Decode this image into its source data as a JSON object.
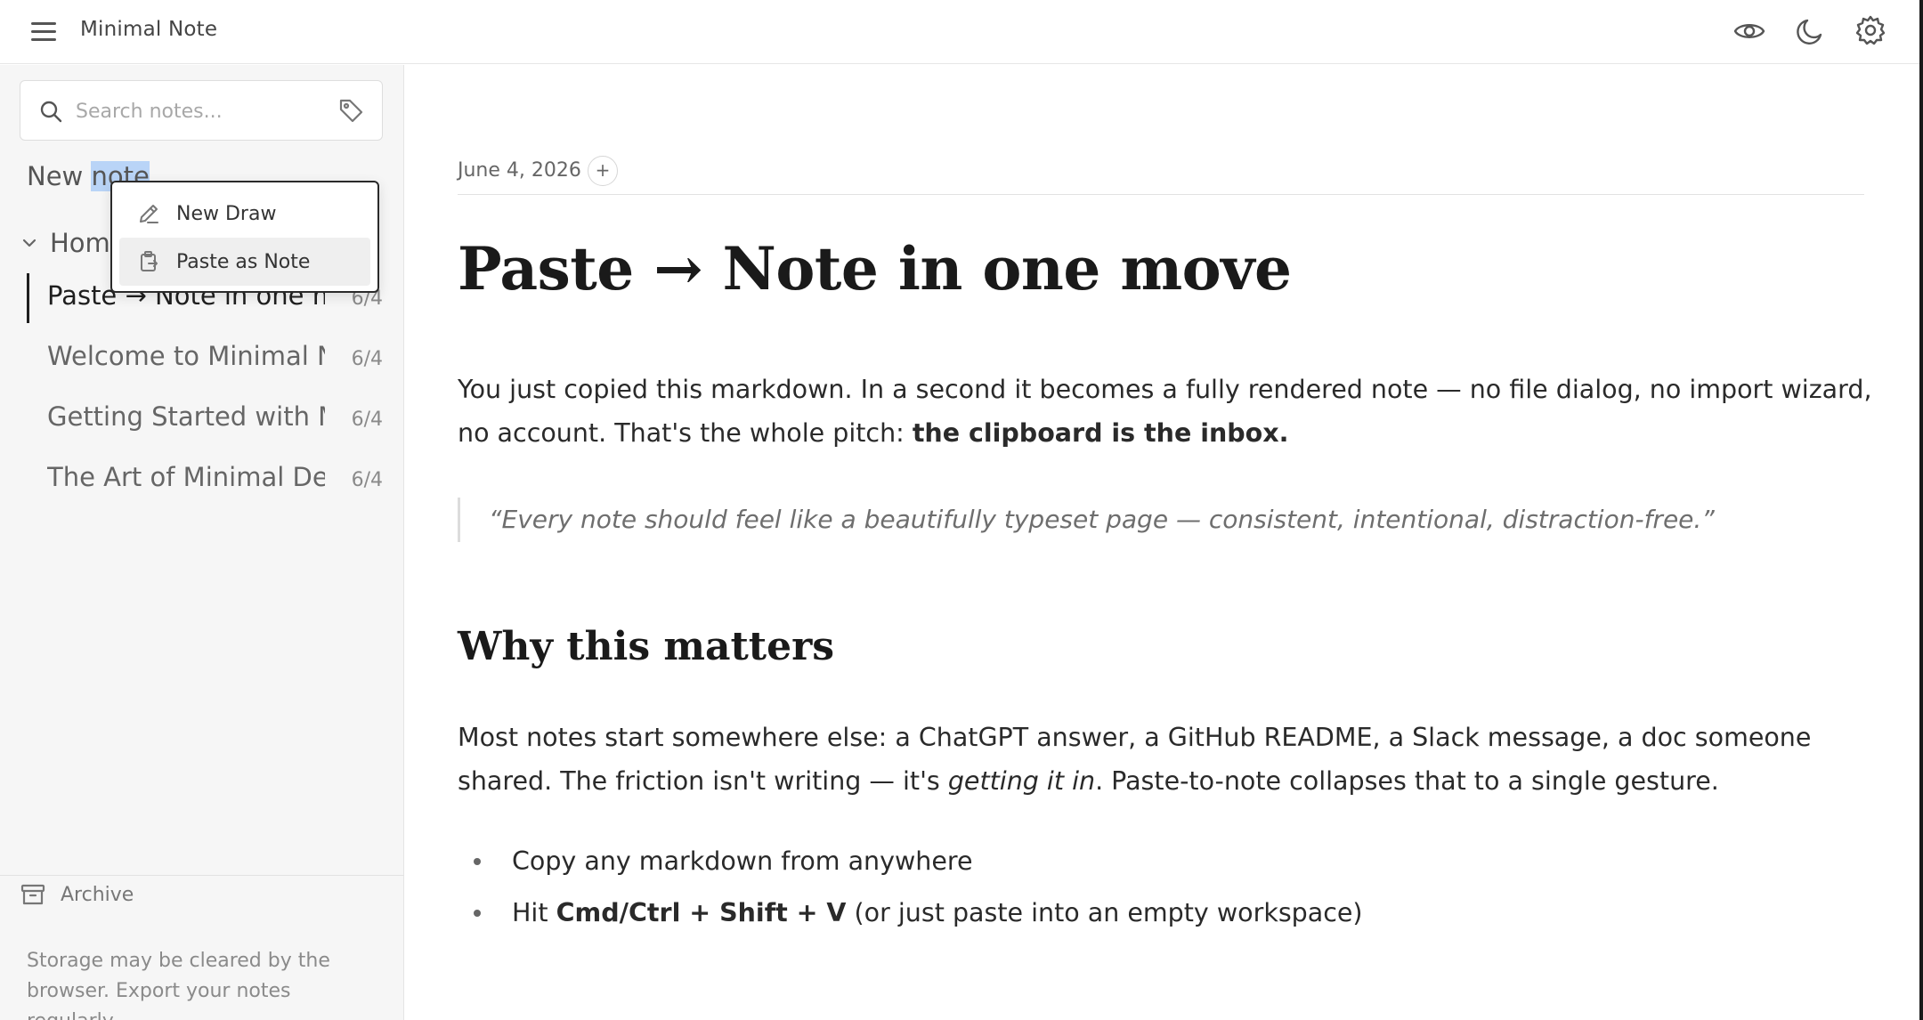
{
  "app": {
    "title": "Minimal Note"
  },
  "header": {
    "icons": [
      "menu-icon",
      "eye-icon",
      "moon-icon",
      "gear-icon"
    ]
  },
  "sidebar": {
    "search_placeholder": "Search notes...",
    "new_note_prefix": "New ",
    "new_note_selected": "note",
    "folder": {
      "label": "Home",
      "expanded": true
    },
    "notes": [
      {
        "title": "Paste → Note in one move",
        "date": "6/4",
        "active": true
      },
      {
        "title": "Welcome to Minimal Note",
        "date": "6/4",
        "active": false
      },
      {
        "title": "Getting Started with Minimal Note",
        "date": "6/4",
        "active": false
      },
      {
        "title": "The Art of Minimal Design",
        "date": "6/4",
        "active": false
      }
    ],
    "archive_label": "Archive",
    "storage_note": "Storage may be cleared by the browser. Export your notes regularly."
  },
  "context_menu": {
    "items": [
      {
        "label": "New Draw",
        "icon": "pencil-icon"
      },
      {
        "label": "Paste as Note",
        "icon": "clipboard-icon",
        "hovered": true
      }
    ]
  },
  "note": {
    "date": "June 4, 2026",
    "add_tag": "+",
    "title": "Paste → Note in one move",
    "p1_a": "You just copied this markdown. In a second it becomes a fully rendered note — no file dialog, no import wizard, no account. That's the whole pitch: ",
    "p1_b": "the clipboard is the inbox.",
    "quote": "“Every note should feel like a beautifully typeset page — consistent, intentional, distraction-free.”",
    "h2": "Why this matters",
    "p2_a": "Most notes start somewhere else: a ChatGPT answer, a GitHub README, a Slack message, a doc someone shared. The friction isn't writing — it's ",
    "p2_b": "getting it in",
    "p2_c": ". Paste-to-note collapses that to a single gesture.",
    "bullet1": "Copy any markdown from anywhere",
    "bullet2_a": "Hit ",
    "bullet2_b": "Cmd/Ctrl + Shift + V",
    "bullet2_c": " (or just paste into an empty workspace)"
  },
  "colors": {
    "accent_selection": "#b9d4f7",
    "sidebar_bg": "#f6f6f6",
    "text_dark": "#1a1a1a"
  }
}
